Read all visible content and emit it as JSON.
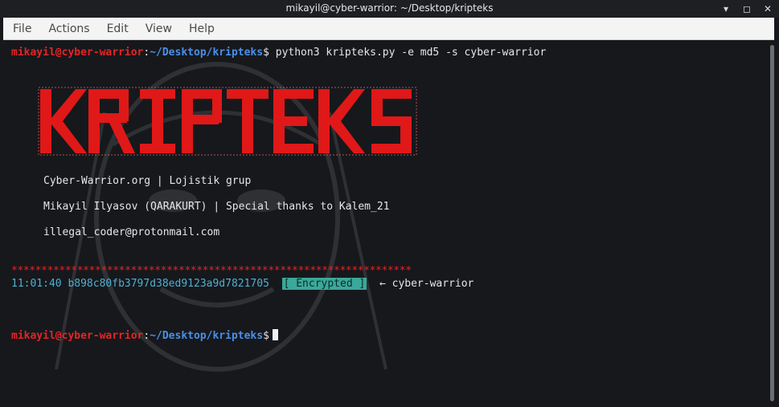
{
  "window": {
    "title": "mikayil@cyber-warrior: ~/Desktop/kripteks",
    "buttons": [
      "minimize",
      "maximize",
      "close"
    ]
  },
  "menu": {
    "items": [
      "File",
      "Actions",
      "Edit",
      "View",
      "Help"
    ]
  },
  "prompt": {
    "user_host": "mikayil@cyber-warrior",
    "colon": ":",
    "path": "~/Desktop/kripteks",
    "symbol": "$"
  },
  "command": " python3 kripteks.py -e md5 -s cyber-warrior",
  "banner": {
    "text": "KRIPTEKS",
    "color": "#e01818"
  },
  "info": {
    "line1": "Cyber-Warrior.org | Lojistik grup",
    "line2": "Mikayil Ilyasov (QARAKURT) | Special thanks to Kalem_21",
    "line3": "illegal_coder@protonmail.com"
  },
  "separator": "*******************************************************************",
  "result": {
    "time": "11:01:40",
    "hash": "b898c80fb3797d38ed9123a9d7821705",
    "status": "[ Encrypted ]",
    "arrow": "←",
    "input": "cyber-warrior"
  },
  "colors": {
    "user": "#e52424",
    "path": "#4a8fe8",
    "accent": "#3aa89a",
    "hash": "#4fb0d0",
    "background": "#16181c"
  }
}
